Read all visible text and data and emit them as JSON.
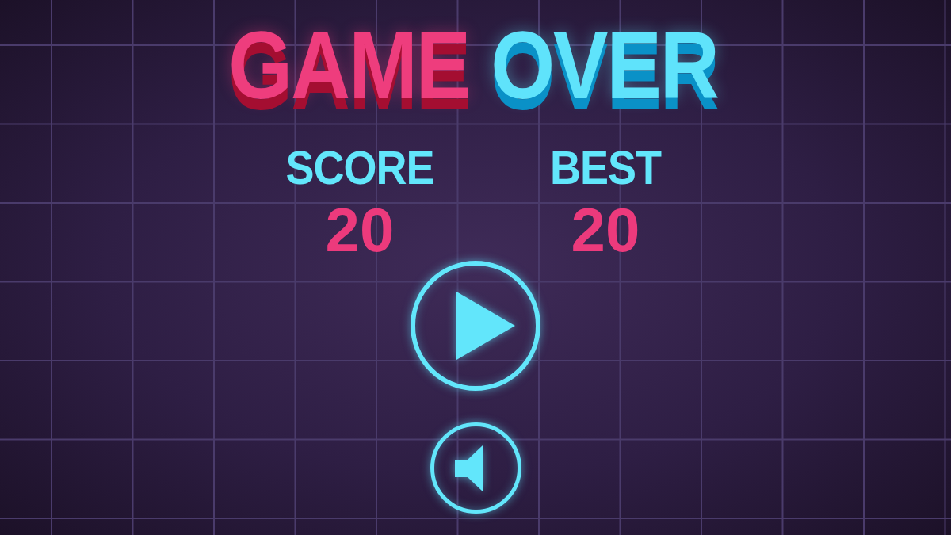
{
  "title": {
    "words": [
      {
        "text": "GAME",
        "color": "#ee3d7d"
      },
      {
        "text": "OVER",
        "color": "#5fe3fb"
      }
    ]
  },
  "stats": [
    {
      "label": "SCORE",
      "value": "20"
    },
    {
      "label": "BEST",
      "value": "20"
    }
  ],
  "buttons": [
    {
      "kind": "play"
    },
    {
      "kind": "sound"
    }
  ]
}
